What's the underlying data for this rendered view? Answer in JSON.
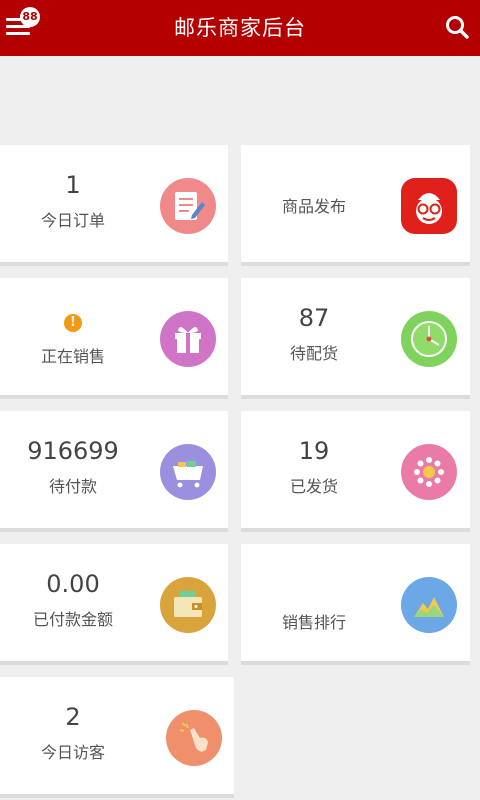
{
  "header": {
    "title": "邮乐商家后台",
    "badge": "88"
  },
  "stats": [
    {
      "value": "1",
      "label": "今日订单",
      "icon": "order-list-icon",
      "color": "#f08a8a"
    },
    {
      "value": "",
      "label": "商品发布",
      "icon": "mascot-icon",
      "color": "#e0201b"
    },
    {
      "value": "",
      "label": "正在销售",
      "icon": "gift-icon",
      "color": "#cf74c6",
      "warning": "!"
    },
    {
      "value": "87",
      "label": "待配货",
      "icon": "clock-icon",
      "color": "#7fd35c"
    },
    {
      "value": "916699",
      "label": "待付款",
      "icon": "cart-icon",
      "color": "#9b8fe0"
    },
    {
      "value": "19",
      "label": "已发货",
      "icon": "coin-flower-icon",
      "color": "#ea7aa6"
    },
    {
      "value": "0.00",
      "label": "已付款金额",
      "icon": "wallet-icon",
      "color": "#d9a43c"
    },
    {
      "value": "",
      "label": "销售排行",
      "icon": "mountain-chart-icon",
      "color": "#6ba8e5"
    },
    {
      "value": "2",
      "label": "今日访客",
      "icon": "pointing-hand-icon",
      "color": "#ef8f6b"
    }
  ]
}
